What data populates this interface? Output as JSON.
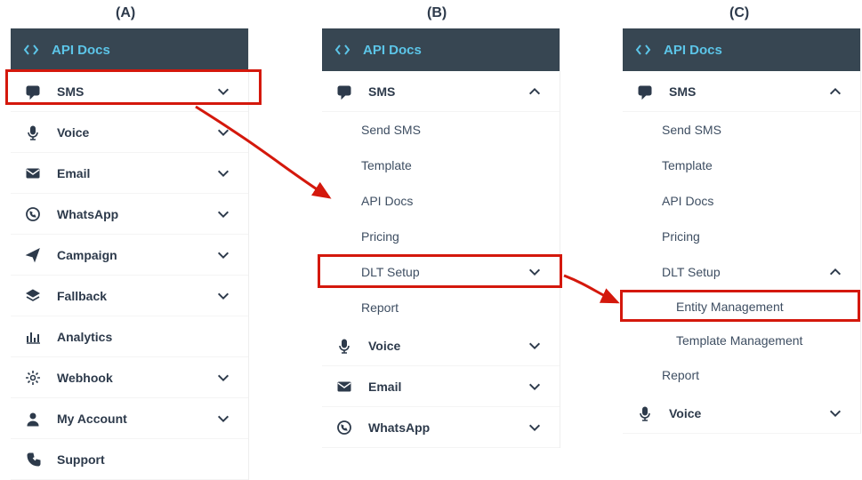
{
  "steps": [
    "(A)",
    "(B)",
    "(C)"
  ],
  "header": {
    "title": "API Docs",
    "icon": "code-icon"
  },
  "panel_a": {
    "items": [
      {
        "label": "SMS",
        "icon": "chat-icon",
        "arrow": "down"
      },
      {
        "label": "Voice",
        "icon": "mic-icon",
        "arrow": "down"
      },
      {
        "label": "Email",
        "icon": "envelope-icon",
        "arrow": "down"
      },
      {
        "label": "WhatsApp",
        "icon": "whatsapp-icon",
        "arrow": "down"
      },
      {
        "label": "Campaign",
        "icon": "send-icon",
        "arrow": "down"
      },
      {
        "label": "Fallback",
        "icon": "layers-icon",
        "arrow": "down"
      },
      {
        "label": "Analytics",
        "icon": "chart-icon",
        "arrow": "none"
      },
      {
        "label": "Webhook",
        "icon": "gear-icon",
        "arrow": "down"
      },
      {
        "label": "My Account",
        "icon": "user-icon",
        "arrow": "down"
      },
      {
        "label": "Support",
        "icon": "phone-icon",
        "arrow": "none"
      }
    ]
  },
  "panel_b": {
    "items": [
      {
        "label": "SMS",
        "icon": "chat-icon",
        "arrow": "up"
      },
      {
        "label": "Send SMS",
        "sub": 1
      },
      {
        "label": "Template",
        "sub": 1
      },
      {
        "label": "API Docs",
        "sub": 1
      },
      {
        "label": "Pricing",
        "sub": 1
      },
      {
        "label": "DLT Setup",
        "sub": 1,
        "arrow": "down"
      },
      {
        "label": "Report",
        "sub": 1
      },
      {
        "label": "Voice",
        "icon": "mic-icon",
        "arrow": "down"
      },
      {
        "label": "Email",
        "icon": "envelope-icon",
        "arrow": "down"
      },
      {
        "label": "WhatsApp",
        "icon": "whatsapp-icon",
        "arrow": "down"
      }
    ]
  },
  "panel_c": {
    "items": [
      {
        "label": "SMS",
        "icon": "chat-icon",
        "arrow": "up"
      },
      {
        "label": "Send SMS",
        "sub": 1
      },
      {
        "label": "Template",
        "sub": 1
      },
      {
        "label": "API Docs",
        "sub": 1
      },
      {
        "label": "Pricing",
        "sub": 1
      },
      {
        "label": "DLT Setup",
        "sub": 1,
        "arrow": "up"
      },
      {
        "label": "Entity Management",
        "sub": 2
      },
      {
        "label": "Template Management",
        "sub": 2
      },
      {
        "label": "Report",
        "sub": 1
      },
      {
        "label": "Voice",
        "icon": "mic-icon",
        "arrow": "down"
      }
    ]
  },
  "highlights": {
    "a": "SMS",
    "b": "DLT Setup",
    "c": "Entity Management"
  },
  "colors": {
    "header_bg": "#374652",
    "header_fg": "#5cc5e8",
    "text": "#2d3a4b",
    "highlight": "#d4180c",
    "arrow": "#d4180c"
  }
}
